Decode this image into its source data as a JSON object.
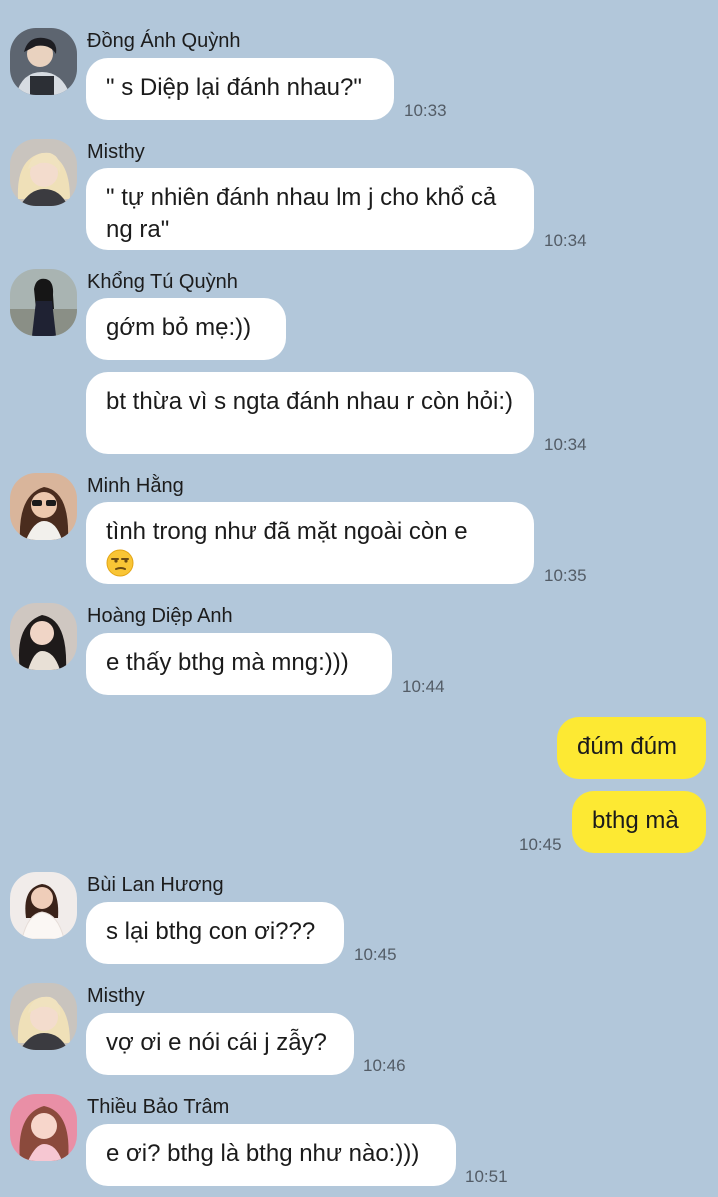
{
  "messages": [
    {
      "sender": "Đồng Ánh Quỳnh",
      "text": "\" s Diệp lại đánh nhau?\"",
      "time": "10:33"
    },
    {
      "sender": "Misthy",
      "text": "\" tự nhiên đánh nhau lm j cho khổ cả ng ra\"",
      "time": "10:34"
    },
    {
      "sender": "Khổng Tú Quỳnh",
      "text": "gớm bỏ mẹ:))"
    },
    {
      "text": "bt thừa vì s ngta đánh nhau r còn hỏi:)",
      "time": "10:34"
    },
    {
      "sender": "Minh Hằng",
      "text": "tình trong như đã mặt ngoài còn e",
      "emoji": "unamused-face",
      "time": "10:35"
    },
    {
      "sender": "Hoàng Diệp Anh",
      "text": "e thấy bthg mà mng:)))",
      "time": "10:44"
    },
    {
      "text": "đúm đúm",
      "own": true
    },
    {
      "text": "bthg mà",
      "own": true,
      "time": "10:45"
    },
    {
      "sender": "Bùi Lan Hương",
      "text": "s lại bthg con ơi???",
      "time": "10:45"
    },
    {
      "sender": "Misthy",
      "text": "vợ ơi e nói cái j zẫy?",
      "time": "10:46"
    },
    {
      "sender": "Thiều Bảo Trâm",
      "text": "e ơi? bthg là bthg như nào:)))",
      "time": "10:51"
    }
  ],
  "colors": {
    "background": "#b2c7da",
    "incoming_bubble": "#ffffff",
    "outgoing_bubble": "#fde933"
  }
}
